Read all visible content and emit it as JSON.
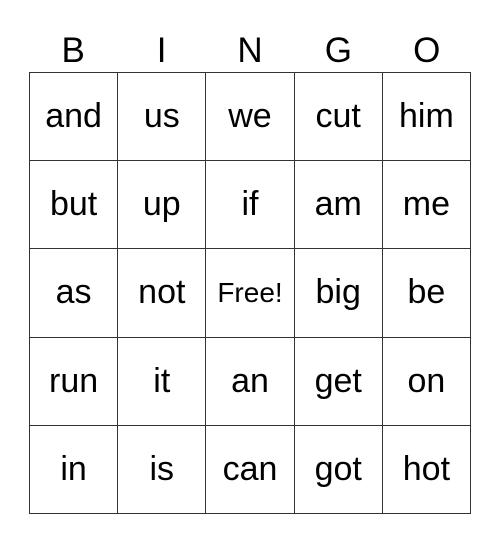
{
  "header": [
    "B",
    "I",
    "N",
    "G",
    "O"
  ],
  "cells": [
    [
      "and",
      "us",
      "we",
      "cut",
      "him"
    ],
    [
      "but",
      "up",
      "if",
      "am",
      "me"
    ],
    [
      "as",
      "not",
      "Free!",
      "big",
      "be"
    ],
    [
      "run",
      "it",
      "an",
      "get",
      "on"
    ],
    [
      "in",
      "is",
      "can",
      "got",
      "hot"
    ]
  ]
}
